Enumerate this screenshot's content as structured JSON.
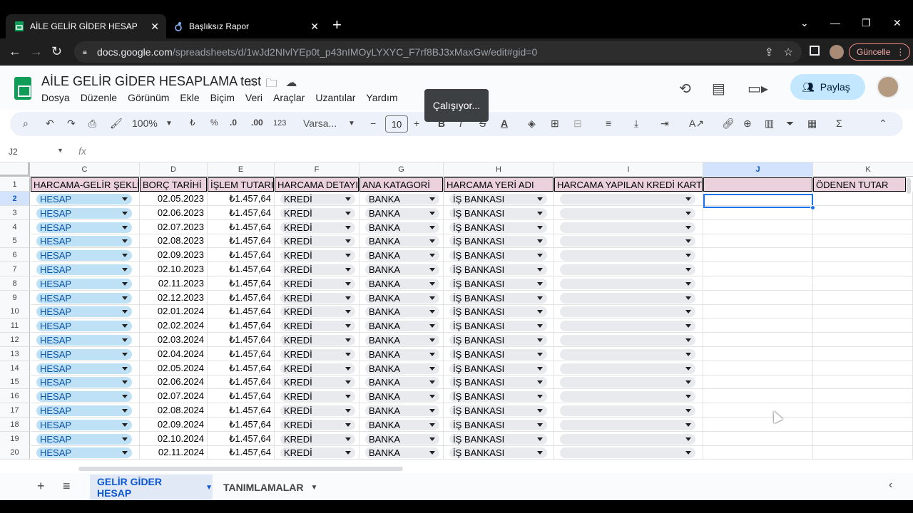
{
  "browser": {
    "tabs": [
      {
        "title": "AİLE GELİR GİDER HESAPLAMA t",
        "active": true
      },
      {
        "title": "Başlıksız Rapor",
        "active": false
      }
    ],
    "url_host": "docs.google.com",
    "url_path": "/spreadsheets/d/1wJd2NIvlYEp0t_p43nIMOyLYXYC_F7rf8BJ3xMaxGw/edit#gid=0",
    "update_label": "Güncelle"
  },
  "sheets": {
    "title": "AİLE GELİR GİDER HESAPLAMA test",
    "menus": [
      "Dosya",
      "Düzenle",
      "Görünüm",
      "Ekle",
      "Biçim",
      "Veri",
      "Araçlar",
      "Uzantılar",
      "Yardım"
    ],
    "share_label": "Paylaş",
    "tooltip": "Çalışıyor...",
    "toolbar": {
      "zoom": "100%",
      "currency": "₺",
      "percent": "%",
      "dec_less": ".0",
      "dec_more": ".00",
      "format_123": "123",
      "font": "Varsa...",
      "font_size": "10"
    },
    "namebox": "J2",
    "fx": "fx"
  },
  "grid": {
    "columns": [
      "C",
      "D",
      "E",
      "F",
      "G",
      "H",
      "I",
      "J",
      "K"
    ],
    "selected_column": "J",
    "selected_row": 2,
    "headers": {
      "C": "HARCAMA-GELİR ŞEKLİ",
      "D": "BORÇ TARİHİ",
      "E": "İŞLEM TUTARI",
      "F": "HARCAMA DETAYI",
      "G": "ANA KATAGORİ",
      "H": "HARCAMA YERİ ADI",
      "I": "HARCAMA YAPILAN KREDİ KARTI",
      "J": "",
      "K": "ÖDENEN TUTAR"
    },
    "rows": [
      {
        "n": "2",
        "c": "HESAP",
        "d": "02.05.2023",
        "e": "₺1.457,64",
        "f": "KREDİ",
        "g": "BANKA",
        "h": "İŞ BANKASI"
      },
      {
        "n": "3",
        "c": "HESAP",
        "d": "02.06.2023",
        "e": "₺1.457,64",
        "f": "KREDİ",
        "g": "BANKA",
        "h": "İŞ BANKASI"
      },
      {
        "n": "4",
        "c": "HESAP",
        "d": "02.07.2023",
        "e": "₺1.457,64",
        "f": "KREDİ",
        "g": "BANKA",
        "h": "İŞ BANKASI"
      },
      {
        "n": "5",
        "c": "HESAP",
        "d": "02.08.2023",
        "e": "₺1.457,64",
        "f": "KREDİ",
        "g": "BANKA",
        "h": "İŞ BANKASI"
      },
      {
        "n": "6",
        "c": "HESAP",
        "d": "02.09.2023",
        "e": "₺1.457,64",
        "f": "KREDİ",
        "g": "BANKA",
        "h": "İŞ BANKASI"
      },
      {
        "n": "7",
        "c": "HESAP",
        "d": "02.10.2023",
        "e": "₺1.457,64",
        "f": "KREDİ",
        "g": "BANKA",
        "h": "İŞ BANKASI"
      },
      {
        "n": "8",
        "c": "HESAP",
        "d": "02.11.2023",
        "e": "₺1.457,64",
        "f": "KREDİ",
        "g": "BANKA",
        "h": "İŞ BANKASI"
      },
      {
        "n": "9",
        "c": "HESAP",
        "d": "02.12.2023",
        "e": "₺1.457,64",
        "f": "KREDİ",
        "g": "BANKA",
        "h": "İŞ BANKASI"
      },
      {
        "n": "10",
        "c": "HESAP",
        "d": "02.01.2024",
        "e": "₺1.457,64",
        "f": "KREDİ",
        "g": "BANKA",
        "h": "İŞ BANKASI"
      },
      {
        "n": "11",
        "c": "HESAP",
        "d": "02.02.2024",
        "e": "₺1.457,64",
        "f": "KREDİ",
        "g": "BANKA",
        "h": "İŞ BANKASI"
      },
      {
        "n": "12",
        "c": "HESAP",
        "d": "02.03.2024",
        "e": "₺1.457,64",
        "f": "KREDİ",
        "g": "BANKA",
        "h": "İŞ BANKASI"
      },
      {
        "n": "13",
        "c": "HESAP",
        "d": "02.04.2024",
        "e": "₺1.457,64",
        "f": "KREDİ",
        "g": "BANKA",
        "h": "İŞ BANKASI"
      },
      {
        "n": "14",
        "c": "HESAP",
        "d": "02.05.2024",
        "e": "₺1.457,64",
        "f": "KREDİ",
        "g": "BANKA",
        "h": "İŞ BANKASI"
      },
      {
        "n": "15",
        "c": "HESAP",
        "d": "02.06.2024",
        "e": "₺1.457,64",
        "f": "KREDİ",
        "g": "BANKA",
        "h": "İŞ BANKASI"
      },
      {
        "n": "16",
        "c": "HESAP",
        "d": "02.07.2024",
        "e": "₺1.457,64",
        "f": "KREDİ",
        "g": "BANKA",
        "h": "İŞ BANKASI"
      },
      {
        "n": "17",
        "c": "HESAP",
        "d": "02.08.2024",
        "e": "₺1.457,64",
        "f": "KREDİ",
        "g": "BANKA",
        "h": "İŞ BANKASI"
      },
      {
        "n": "18",
        "c": "HESAP",
        "d": "02.09.2024",
        "e": "₺1.457,64",
        "f": "KREDİ",
        "g": "BANKA",
        "h": "İŞ BANKASI"
      },
      {
        "n": "19",
        "c": "HESAP",
        "d": "02.10.2024",
        "e": "₺1.457,64",
        "f": "KREDİ",
        "g": "BANKA",
        "h": "İŞ BANKASI"
      },
      {
        "n": "20",
        "c": "HESAP",
        "d": "02.11.2024",
        "e": "₺1.457,64",
        "f": "KREDİ",
        "g": "BANKA",
        "h": "İŞ BANKASI"
      }
    ]
  },
  "sheet_tabs": [
    {
      "label": "GELİR GİDER HESAP",
      "active": true
    },
    {
      "label": "TANIMLAMALAR",
      "active": false
    }
  ],
  "colors": {
    "header_fill": "#ead1dc",
    "chip_blue": "#bfe1f6",
    "chip_gray": "#e8eaed",
    "selection": "#1a73e8",
    "share_bg": "#c2e7ff"
  }
}
